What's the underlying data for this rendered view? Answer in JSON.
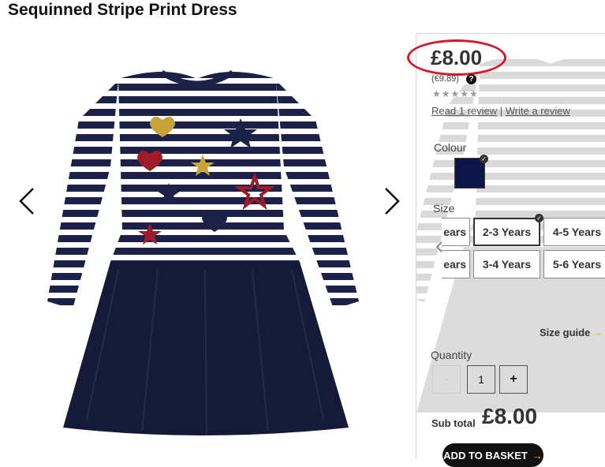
{
  "product": {
    "title": "Sequinned Stripe Print Dress",
    "price": "£8.00",
    "price_euro": "(€9.89)",
    "help_icon": "?",
    "rating_stars": "★★★★★",
    "read_review": "Read 1 review",
    "separator": "|",
    "write_review": "Write a review"
  },
  "colour": {
    "label": "Colour",
    "selected_hex": "#0c1448"
  },
  "size": {
    "label": "Size",
    "options": [
      "ears",
      "2-3 Years",
      "4-5 Years",
      "ears",
      "3-4 Years",
      "5-6 Years"
    ],
    "selected": "2-3 Years",
    "guide": "Size guide",
    "guide_arrow": "→"
  },
  "quantity": {
    "label": "Quantity",
    "minus": "-",
    "value": "1",
    "plus": "+"
  },
  "subtotal": {
    "label": "Sub total",
    "value": "£8.00"
  },
  "basket": {
    "label": "ADD TO BASKET",
    "arrow": "→"
  },
  "colors": {
    "navy": "#0c1448",
    "accent": "#f0b400",
    "highlight": "#d6182a"
  }
}
